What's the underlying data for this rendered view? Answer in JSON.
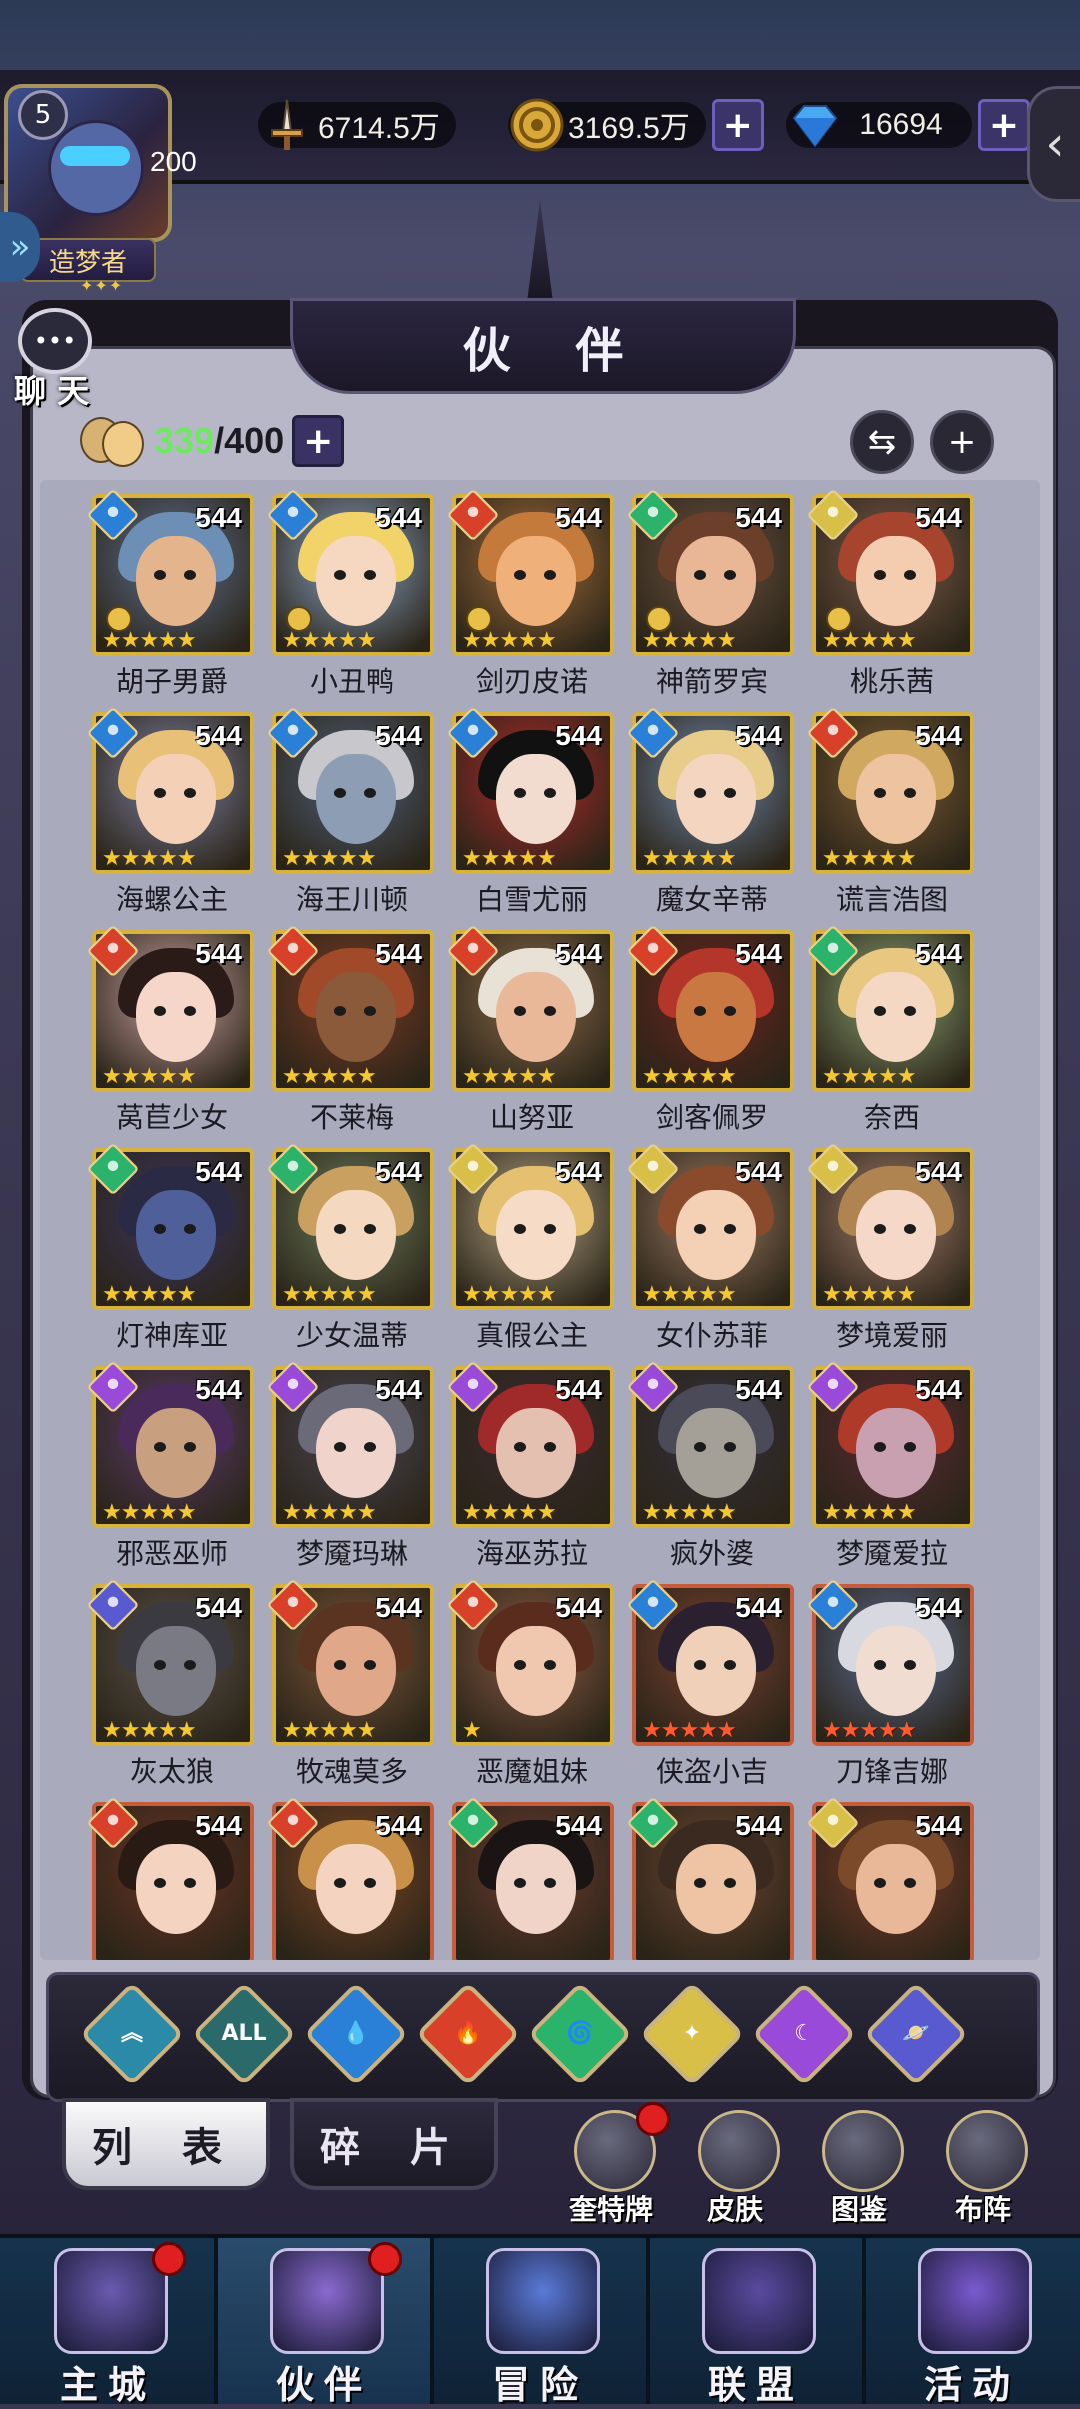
{
  "header": {
    "avatar": {
      "level": "5",
      "number": "200",
      "title": "造梦者"
    },
    "resources": [
      {
        "name": "power",
        "icon": "sword-icon",
        "value": "6714.5万",
        "has_plus": false
      },
      {
        "name": "gold",
        "icon": "gold-coin-icon",
        "value": "3169.5万",
        "has_plus": true
      },
      {
        "name": "diamond",
        "icon": "diamond-icon",
        "value": "16694",
        "has_plus": true
      }
    ],
    "plus": "+",
    "back_symbol": "‹"
  },
  "chat": {
    "label": "聊 天",
    "dots": "•••"
  },
  "panel": {
    "title": "伙 伴",
    "count_current": "339",
    "count_sep": "/",
    "count_max": "400",
    "swap_symbol": "⇆",
    "add_symbol": "+"
  },
  "heroes": [
    {
      "name": "胡子男爵",
      "level": "544",
      "element": "water",
      "stars": 5,
      "tier": "gold",
      "pawn": true,
      "hair": "#6d8fb5",
      "skin": "#e4b58c",
      "bg": "#5d6f8f"
    },
    {
      "name": "小丑鸭",
      "level": "544",
      "element": "water",
      "stars": 5,
      "tier": "gold",
      "pawn": true,
      "hair": "#f2d36a",
      "skin": "#f6d7c0",
      "bg": "#8aa3c4"
    },
    {
      "name": "剑刃皮诺",
      "level": "544",
      "element": "fire",
      "stars": 5,
      "tier": "gold",
      "pawn": true,
      "hair": "#c47a3a",
      "skin": "#f0b07a",
      "bg": "#a06b3a"
    },
    {
      "name": "神箭罗宾",
      "level": "544",
      "element": "wind",
      "stars": 5,
      "tier": "gold",
      "pawn": true,
      "hair": "#6b3f2a",
      "skin": "#eab796",
      "bg": "#6b5140"
    },
    {
      "name": "桃乐茜",
      "level": "544",
      "element": "light",
      "stars": 5,
      "tier": "gold",
      "pawn": true,
      "hair": "#a6442e",
      "skin": "#f4cdb0",
      "bg": "#7a5a4a"
    },
    {
      "name": "海螺公主",
      "level": "544",
      "element": "water",
      "stars": 5,
      "tier": "gold",
      "pawn": false,
      "hair": "#e8c078",
      "skin": "#f4d0b6",
      "bg": "#7d7fa0"
    },
    {
      "name": "海王川顿",
      "level": "544",
      "element": "water",
      "stars": 5,
      "tier": "gold",
      "pawn": false,
      "hair": "#c8c8cc",
      "skin": "#8c9db4",
      "bg": "#4f5f78"
    },
    {
      "name": "白雪尤丽",
      "level": "544",
      "element": "water",
      "stars": 5,
      "tier": "gold",
      "pawn": false,
      "hair": "#111111",
      "skin": "#f2dcd0",
      "bg": "#b02a2a"
    },
    {
      "name": "魔女辛蒂",
      "level": "544",
      "element": "water",
      "stars": 5,
      "tier": "gold",
      "pawn": false,
      "hair": "#e8cc8a",
      "skin": "#f4d6c0",
      "bg": "#6f86a8"
    },
    {
      "name": "谎言浩图",
      "level": "544",
      "element": "fire",
      "stars": 5,
      "tier": "gold",
      "pawn": false,
      "hair": "#d0a860",
      "skin": "#eec4a0",
      "bg": "#7a5a32"
    },
    {
      "name": "莴苣少女",
      "level": "544",
      "element": "fire",
      "stars": 5,
      "tier": "gold",
      "pawn": false,
      "hair": "#2a1a18",
      "skin": "#f6d6c8",
      "bg": "#c8a0a0"
    },
    {
      "name": "不莱梅",
      "level": "544",
      "element": "fire",
      "stars": 5,
      "tier": "gold",
      "pawn": false,
      "hair": "#a04a2a",
      "skin": "#8a5a3a",
      "bg": "#7a3a24"
    },
    {
      "name": "山努亚",
      "level": "544",
      "element": "fire",
      "stars": 5,
      "tier": "gold",
      "pawn": false,
      "hair": "#e8e2d6",
      "skin": "#e8b898",
      "bg": "#8a6a4a"
    },
    {
      "name": "剑客佩罗",
      "level": "544",
      "element": "fire",
      "stars": 5,
      "tier": "gold",
      "pawn": false,
      "hair": "#b4362a",
      "skin": "#c87840",
      "bg": "#6a2420"
    },
    {
      "name": "奈西",
      "level": "544",
      "element": "wind",
      "stars": 5,
      "tier": "gold",
      "pawn": false,
      "hair": "#e8c880",
      "skin": "#f4d8c4",
      "bg": "#8aa070"
    },
    {
      "name": "灯神库亚",
      "level": "544",
      "element": "wind",
      "stars": 5,
      "tier": "gold",
      "pawn": false,
      "hair": "#2a2a44",
      "skin": "#4f5f9a",
      "bg": "#3a3460"
    },
    {
      "name": "少女温蒂",
      "level": "544",
      "element": "wind",
      "stars": 5,
      "tier": "gold",
      "pawn": false,
      "hair": "#caa060",
      "skin": "#f4d8c0",
      "bg": "#6a7a5a"
    },
    {
      "name": "真假公主",
      "level": "544",
      "element": "light",
      "stars": 5,
      "tier": "gold",
      "pawn": false,
      "hair": "#e4c070",
      "skin": "#f6dcc6",
      "bg": "#b0a080"
    },
    {
      "name": "女仆苏菲",
      "level": "544",
      "element": "light",
      "stars": 5,
      "tier": "gold",
      "pawn": false,
      "hair": "#8a4a2c",
      "skin": "#f4d0b4",
      "bg": "#9a7860"
    },
    {
      "name": "梦境爱丽",
      "level": "544",
      "element": "light",
      "stars": 5,
      "tier": "gold",
      "pawn": false,
      "hair": "#b08450",
      "skin": "#f6d8c8",
      "bg": "#a07a6a"
    },
    {
      "name": "邪恶巫师",
      "level": "544",
      "element": "dark",
      "stars": 5,
      "tier": "gold",
      "pawn": false,
      "hair": "#4a2a5a",
      "skin": "#c8a080",
      "bg": "#5a3a6a"
    },
    {
      "name": "梦魇玛琳",
      "level": "544",
      "element": "dark",
      "stars": 5,
      "tier": "gold",
      "pawn": false,
      "hair": "#6a6a78",
      "skin": "#f0d4cc",
      "bg": "#4a4454"
    },
    {
      "name": "海巫苏拉",
      "level": "544",
      "element": "dark",
      "stars": 5,
      "tier": "gold",
      "pawn": false,
      "hair": "#a02a2a",
      "skin": "#e4c0b0",
      "bg": "#3a2a30"
    },
    {
      "name": "疯外婆",
      "level": "544",
      "element": "dark",
      "stars": 5,
      "tier": "gold",
      "pawn": false,
      "hair": "#4a4a58",
      "skin": "#a4a098",
      "bg": "#34303c"
    },
    {
      "name": "梦魇爱拉",
      "level": "544",
      "element": "dark",
      "stars": 5,
      "tier": "gold",
      "pawn": false,
      "hair": "#b03a2a",
      "skin": "#c8a0b0",
      "bg": "#5a2a34"
    },
    {
      "name": "灰太狼",
      "level": "544",
      "element": "cosmic",
      "stars": 5,
      "tier": "gold",
      "pawn": false,
      "hair": "#3a3a40",
      "skin": "#7a7a84",
      "bg": "#5a5048"
    },
    {
      "name": "牧魂莫多",
      "level": "544",
      "element": "fire",
      "stars": 5,
      "tier": "gold",
      "pawn": false,
      "hair": "#5a3420",
      "skin": "#e0a888",
      "bg": "#7a5438"
    },
    {
      "name": "恶魔姐妹",
      "level": "544",
      "element": "fire",
      "stars": 1,
      "tier": "gold",
      "pawn": false,
      "hair": "#5a2c1e",
      "skin": "#f0c8b0",
      "bg": "#8a5a44"
    },
    {
      "name": "侠盗小吉",
      "level": "544",
      "element": "water",
      "stars": 5,
      "tier": "red",
      "pawn": false,
      "hair": "#2a2030",
      "skin": "#f0d0b8",
      "bg": "#7a4030"
    },
    {
      "name": "刀锋吉娜",
      "level": "544",
      "element": "water",
      "stars": 5,
      "tier": "red",
      "pawn": false,
      "hair": "#d8d8e0",
      "skin": "#f0dcd0",
      "bg": "#5a6a90"
    },
    {
      "name": "",
      "level": "544",
      "element": "fire",
      "stars": 0,
      "tier": "red",
      "pawn": false,
      "hair": "#2a1a14",
      "skin": "#f4d4c0",
      "bg": "#6a3424"
    },
    {
      "name": "",
      "level": "544",
      "element": "fire",
      "stars": 0,
      "tier": "red",
      "pawn": false,
      "hair": "#c89048",
      "skin": "#f4d4c0",
      "bg": "#7a4424"
    },
    {
      "name": "",
      "level": "544",
      "element": "wind",
      "stars": 0,
      "tier": "red",
      "pawn": false,
      "hair": "#1a1414",
      "skin": "#f0d4c8",
      "bg": "#6a3a30"
    },
    {
      "name": "",
      "level": "544",
      "element": "wind",
      "stars": 0,
      "tier": "red",
      "pawn": false,
      "hair": "#3a2a20",
      "skin": "#eec4a4",
      "bg": "#6a4430"
    },
    {
      "name": "",
      "level": "544",
      "element": "light",
      "stars": 0,
      "tier": "red",
      "pawn": false,
      "hair": "#7a4a2a",
      "skin": "#e8b898",
      "bg": "#7a3a28"
    }
  ],
  "element_colors": {
    "water": "#2a7fd6",
    "fire": "#d8402a",
    "wind": "#2bb36b",
    "light": "#d8c048",
    "dark": "#9a4ad8",
    "cosmic": "#5a5ad0",
    "all": "#2a6a6a"
  },
  "filters": [
    {
      "key": "favorite",
      "color": "#2a8aa8",
      "label": "︽"
    },
    {
      "key": "all",
      "color": "#2a6a6a",
      "label": "ALL"
    },
    {
      "key": "water",
      "color": "#2a7fd6",
      "label": "💧"
    },
    {
      "key": "fire",
      "color": "#d8402a",
      "label": "🔥"
    },
    {
      "key": "wind",
      "color": "#2bb36b",
      "label": "🌀"
    },
    {
      "key": "light",
      "color": "#d8c048",
      "label": "✦"
    },
    {
      "key": "dark",
      "color": "#9a4ad8",
      "label": "☾"
    },
    {
      "key": "cosmic",
      "color": "#5a5ad0",
      "label": "🪐"
    }
  ],
  "subtabs": {
    "list": "列 表",
    "fragments": "碎 片"
  },
  "tools": [
    {
      "label": "奎特牌",
      "badge": true
    },
    {
      "label": "皮肤",
      "badge": false
    },
    {
      "label": "图鉴",
      "badge": false
    },
    {
      "label": "布阵",
      "badge": false
    }
  ],
  "nav": [
    {
      "label": "主城",
      "badge": true,
      "active": false,
      "color": "#6a5ab0"
    },
    {
      "label": "伙伴",
      "badge": true,
      "active": true,
      "color": "#8a6ad0"
    },
    {
      "label": "冒险",
      "badge": false,
      "active": false,
      "color": "#5a7ad8"
    },
    {
      "label": "联盟",
      "badge": false,
      "active": false,
      "color": "#5a4aa0"
    },
    {
      "label": "活动",
      "badge": false,
      "active": false,
      "color": "#7a5ad0"
    }
  ]
}
